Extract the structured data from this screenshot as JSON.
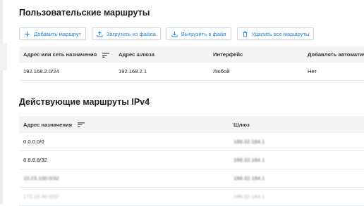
{
  "colors": {
    "accent": "#1e88e5",
    "header_bg": "#f2f4f5",
    "border": "#cfd8dc"
  },
  "custom_routes": {
    "title": "Пользовательские маршруты",
    "buttons": [
      {
        "label": "Добавить маршрут",
        "icon": "plus-icon"
      },
      {
        "label": "Загрузить из файла",
        "icon": "upload-icon"
      },
      {
        "label": "Выгрузить в файл",
        "icon": "download-icon"
      },
      {
        "label": "Удалить все маршруты",
        "icon": "trash-icon"
      }
    ],
    "columns": [
      "Адрес или сеть назначения",
      "Адрес шлюза",
      "Интерфейс",
      "Добавлять автоматиче"
    ],
    "rows": [
      [
        "192.168.2.0/24",
        "192.168.2.1",
        "Любой",
        "Нет"
      ]
    ]
  },
  "active_routes": {
    "title": "Действующие маршруты IPv4",
    "columns": [
      "Адрес назначения",
      "Шлюз"
    ],
    "rows": [
      [
        "0.0.0.0/0",
        "188.32.184.1"
      ],
      [
        "8.8.8.8/32",
        "188.32.184.1"
      ],
      [
        "10.23.100.0/32",
        "188.32.184.1"
      ],
      [
        "172.16.46.0/32",
        "188.32.184.1"
      ]
    ]
  }
}
